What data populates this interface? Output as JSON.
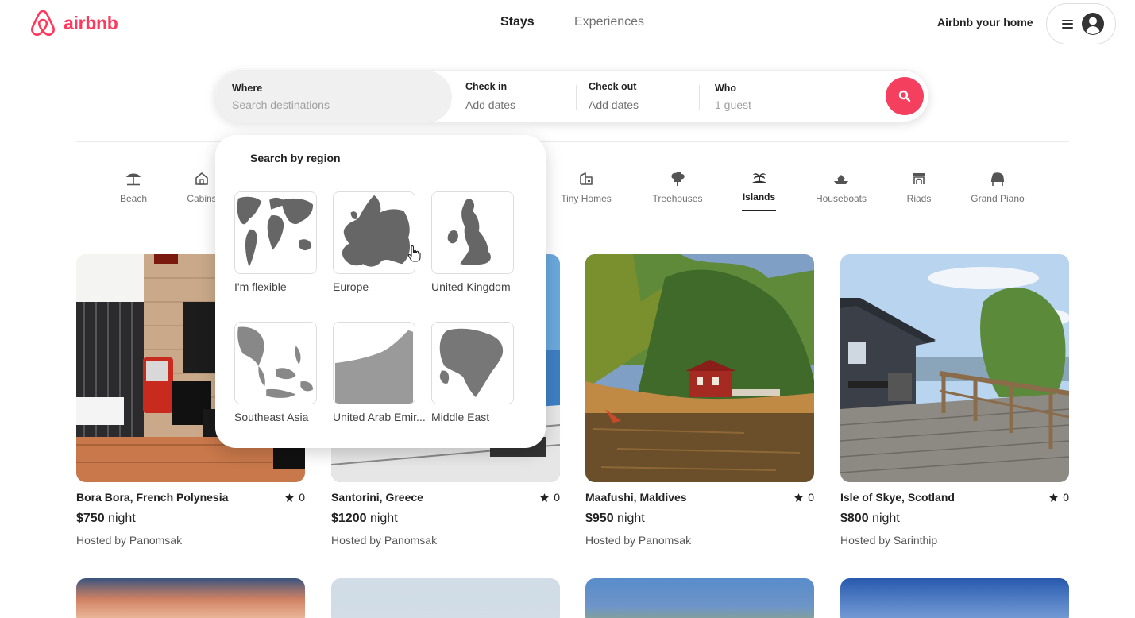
{
  "brand": {
    "name": "airbnb",
    "color": "#FF385C"
  },
  "nav": {
    "tabs": [
      {
        "label": "Stays"
      },
      {
        "label": "Experiences"
      }
    ],
    "host_link": "Airbnb your home"
  },
  "search": {
    "where": {
      "label": "Where",
      "placeholder": "Search destinations"
    },
    "check_in": {
      "label": "Check in",
      "value": "Add dates"
    },
    "check_out": {
      "label": "Check out",
      "value": "Add dates"
    },
    "who": {
      "label": "Who",
      "placeholder": "1 guest"
    },
    "button_color": "#F43F5E"
  },
  "categories": [
    {
      "label": "Beach",
      "icon": "beach-umbrella-icon"
    },
    {
      "label": "Cabins",
      "icon": "cabin-icon"
    },
    {
      "label": "Tiny Homes",
      "icon": "tiny-home-icon"
    },
    {
      "label": "Treehouses",
      "icon": "treehouse-icon"
    },
    {
      "label": "Islands",
      "icon": "island-icon",
      "active": true
    },
    {
      "label": "Houseboats",
      "icon": "houseboat-icon"
    },
    {
      "label": "Riads",
      "icon": "riad-icon"
    },
    {
      "label": "Grand Piano",
      "icon": "grand-piano-icon"
    }
  ],
  "region_dropdown": {
    "title": "Search by region",
    "regions": [
      {
        "label": "I'm flexible"
      },
      {
        "label": "Europe"
      },
      {
        "label": "United Kingdom"
      },
      {
        "label": "Southeast Asia"
      },
      {
        "label": "United Arab Emir..."
      },
      {
        "label": "Middle East"
      }
    ]
  },
  "listings": [
    {
      "title": "Bora Bora, French Polynesia",
      "rating": "0",
      "price": "$750",
      "unit": " night",
      "host": "Hosted by Panomsak"
    },
    {
      "title": "Santorini, Greece",
      "rating": "0",
      "price": "$1200",
      "unit": " night",
      "host": "Hosted by Panomsak"
    },
    {
      "title": "Maafushi, Maldives",
      "rating": "0",
      "price": "$950",
      "unit": " night",
      "host": "Hosted by Panomsak"
    },
    {
      "title": "Isle of Skye, Scotland",
      "rating": "0",
      "price": "$800",
      "unit": " night",
      "host": "Hosted by Sarinthip"
    }
  ]
}
